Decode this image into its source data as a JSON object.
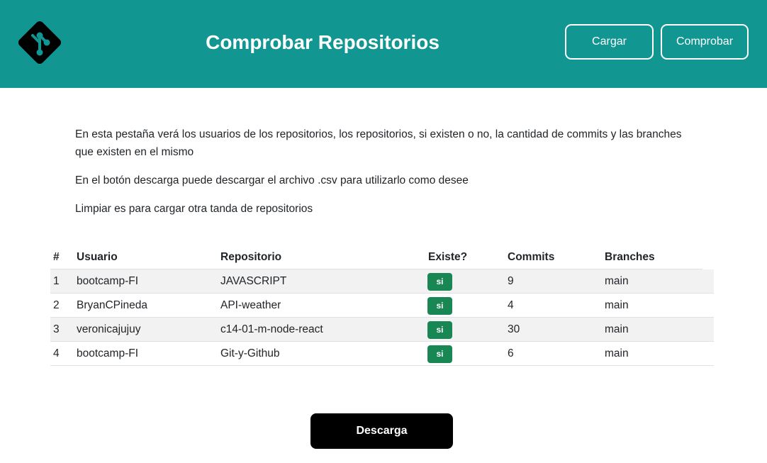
{
  "header": {
    "title": "Comprobar Repositorios",
    "buttons": {
      "cargar": "Cargar",
      "comprobar": "Comprobar"
    },
    "logo_icon": "git-logo-icon",
    "background": "#119692"
  },
  "intro": {
    "p1": "En esta pestaña verá los usuarios de los repositorios, los repositorios, si existen o no, la cantidad de commits y las branches que existen en el mismo",
    "p2": "En el botón descarga puede descargar el archivo .csv para utilizarlo como desee",
    "p3": "Limpiar es para cargar otra tanda de repositorios"
  },
  "table": {
    "columns": [
      "#",
      "Usuario",
      "Repositorio",
      "Existe?",
      "Commits",
      "Branches"
    ],
    "rows": [
      {
        "num": "1",
        "usuario": "bootcamp-FI",
        "repositorio": "JAVASCRIPT",
        "existe": "si",
        "commits": "9",
        "branches": "main"
      },
      {
        "num": "2",
        "usuario": "BryanCPineda",
        "repositorio": "API-weather",
        "existe": "si",
        "commits": "4",
        "branches": "main"
      },
      {
        "num": "3",
        "usuario": "veronicajujuy",
        "repositorio": "c14-01-m-node-react",
        "existe": "si",
        "commits": "30",
        "branches": "main"
      },
      {
        "num": "4",
        "usuario": "bootcamp-FI",
        "repositorio": "Git-y-Github",
        "existe": "si",
        "commits": "6",
        "branches": "main"
      }
    ],
    "badge_color": "#198754"
  },
  "footer": {
    "download_label": "Descarga"
  }
}
